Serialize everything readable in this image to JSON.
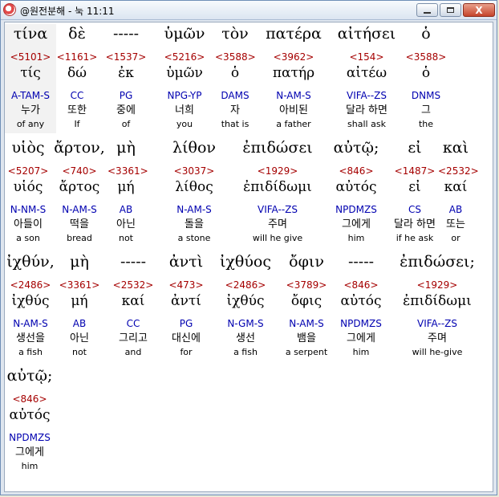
{
  "window": {
    "title": "@원전분해 - 눅 11:11",
    "minimize_label": "",
    "maximize_label": "",
    "close_label": "X"
  },
  "rows": [
    {
      "words": [
        {
          "greek": "τίνα",
          "num": "<5101>",
          "lemma": "τίς",
          "parsing": "A-TAM-S",
          "korean": "누가",
          "english": "of any",
          "selected": true
        },
        {
          "greek": "δὲ",
          "num": "<1161>",
          "lemma": "δώ",
          "parsing": "CC",
          "korean": "또한",
          "english": "If"
        },
        {
          "greek": "-----",
          "num": "<1537>",
          "lemma": "ἐκ",
          "parsing": "PG",
          "korean": "중에",
          "english": "of"
        },
        {
          "greek": "ὑμῶν",
          "num": "<5216>",
          "lemma": "ὑμῶν",
          "parsing": "NPG-YP",
          "korean": "너희",
          "english": "you"
        },
        {
          "greek": "τὸν",
          "num": "<3588>",
          "lemma": "ὁ",
          "parsing": "DAMS",
          "korean": "자",
          "english": "that is"
        },
        {
          "greek": "πατέρα",
          "num": "<3962>",
          "lemma": "πατήρ",
          "parsing": "N-AM-S",
          "korean": "아비된",
          "english": "a father"
        },
        {
          "greek": "αἰτήσει",
          "num": "<154>",
          "lemma": "αἰτέω",
          "parsing": "VIFA--ZS",
          "korean": "달라 하면",
          "english": "shall ask"
        },
        {
          "greek": "ὁ",
          "num": "<3588>",
          "lemma": "ὁ",
          "parsing": "DNMS",
          "korean": "그",
          "english": "the"
        }
      ]
    },
    {
      "words": [
        {
          "greek": "υἱὸς",
          "num": "<5207>",
          "lemma": "υἱός",
          "parsing": "N-NM-S",
          "korean": "아들이",
          "english": "a son"
        },
        {
          "greek": "ἄρτον,",
          "num": "<740>",
          "lemma": "ἄρτος",
          "parsing": "N-AM-S",
          "korean": "떡을",
          "english": "bread"
        },
        {
          "greek": "μὴ",
          "num": "<3361>",
          "lemma": "μή",
          "parsing": "AB",
          "korean": "아닌",
          "english": "not"
        },
        {
          "greek": "λίθον",
          "num": "<3037>",
          "lemma": "λίθος",
          "parsing": "N-AM-S",
          "korean": "돌을",
          "english": "a stone"
        },
        {
          "greek": "ἐπιδώσει",
          "num": "<1929>",
          "lemma": "ἐπιδίδωμι",
          "parsing": "VIFA--ZS",
          "korean": "주며",
          "english": "will he give"
        },
        {
          "greek": "αὐτῷ;",
          "num": "<846>",
          "lemma": "αὐτός",
          "parsing": "NPDMZS",
          "korean": "그에게",
          "english": "him"
        },
        {
          "greek": "εἰ",
          "num": "<1487>",
          "lemma": "εἰ",
          "parsing": "CS",
          "korean": "달라 하면",
          "english": "if he ask"
        },
        {
          "greek": "καὶ",
          "num": "<2532>",
          "lemma": "καί",
          "parsing": "AB",
          "korean": "또는",
          "english": "or"
        }
      ]
    },
    {
      "words": [
        {
          "greek": "ἰχθύν,",
          "num": "<2486>",
          "lemma": "ἰχθύς",
          "parsing": "N-AM-S",
          "korean": "생선을",
          "english": "a fish"
        },
        {
          "greek": "μὴ",
          "num": "<3361>",
          "lemma": "μή",
          "parsing": "AB",
          "korean": "아닌",
          "english": "not"
        },
        {
          "greek": "-----",
          "num": "<2532>",
          "lemma": "καί",
          "parsing": "CC",
          "korean": "그리고",
          "english": "and"
        },
        {
          "greek": "ἀντὶ",
          "num": "<473>",
          "lemma": "ἀντί",
          "parsing": "PG",
          "korean": "대신에",
          "english": "for"
        },
        {
          "greek": "ἰχθύος",
          "num": "<2486>",
          "lemma": "ἰχθύς",
          "parsing": "N-GM-S",
          "korean": "생선",
          "english": "a fish"
        },
        {
          "greek": "ὄφιν",
          "num": "<3789>",
          "lemma": "ὄφις",
          "parsing": "N-AM-S",
          "korean": "뱀을",
          "english": "a serpent"
        },
        {
          "greek": "-----",
          "num": "<846>",
          "lemma": "αὐτός",
          "parsing": "NPDMZS",
          "korean": "그에게",
          "english": "him"
        },
        {
          "greek": "ἐπιδώσει;",
          "num": "<1929>",
          "lemma": "ἐπιδίδωμι",
          "parsing": "VIFA--ZS",
          "korean": "주며",
          "english": "will he-give"
        }
      ]
    },
    {
      "words": [
        {
          "greek": "αὐτῷ;",
          "num": "<846>",
          "lemma": "αὐτός",
          "parsing": "NPDMZS",
          "korean": "그에게",
          "english": "him"
        }
      ]
    }
  ]
}
